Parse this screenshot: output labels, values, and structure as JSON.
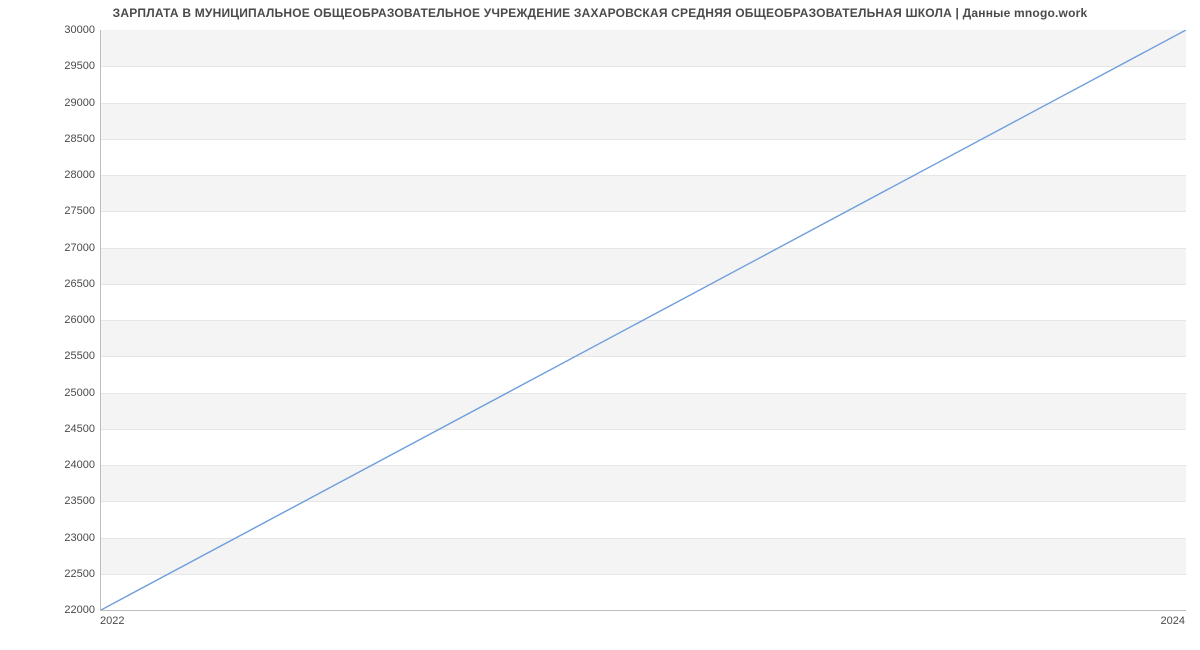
{
  "title": "ЗАРПЛАТА В МУНИЦИПАЛЬНОЕ ОБЩЕОБРАЗОВАТЕЛЬНОЕ УЧРЕЖДЕНИЕ ЗАХАРОВСКАЯ СРЕДНЯЯ ОБЩЕОБРАЗОВАТЕЛЬНАЯ ШКОЛА | Данные mnogo.work",
  "xticks": [
    "2022",
    "2024"
  ],
  "yticks": [
    "22000",
    "22500",
    "23000",
    "23500",
    "24000",
    "24500",
    "25000",
    "25500",
    "26000",
    "26500",
    "27000",
    "27500",
    "28000",
    "28500",
    "29000",
    "29500",
    "30000"
  ],
  "chart_data": {
    "type": "line",
    "x": [
      2022,
      2024
    ],
    "values": [
      22000,
      30000
    ],
    "title": "ЗАРПЛАТА В МУНИЦИПАЛЬНОЕ ОБЩЕОБРАЗОВАТЕЛЬНОЕ УЧРЕЖДЕНИЕ ЗАХАРОВСКАЯ СРЕДНЯЯ ОБЩЕОБРАЗОВАТЕЛЬНАЯ ШКОЛА | Данные mnogo.work",
    "xlabel": "",
    "ylabel": "",
    "xlim": [
      2022,
      2024
    ],
    "ylim": [
      22000,
      30000
    ],
    "grid": true,
    "line_color": "#6e9edc"
  }
}
